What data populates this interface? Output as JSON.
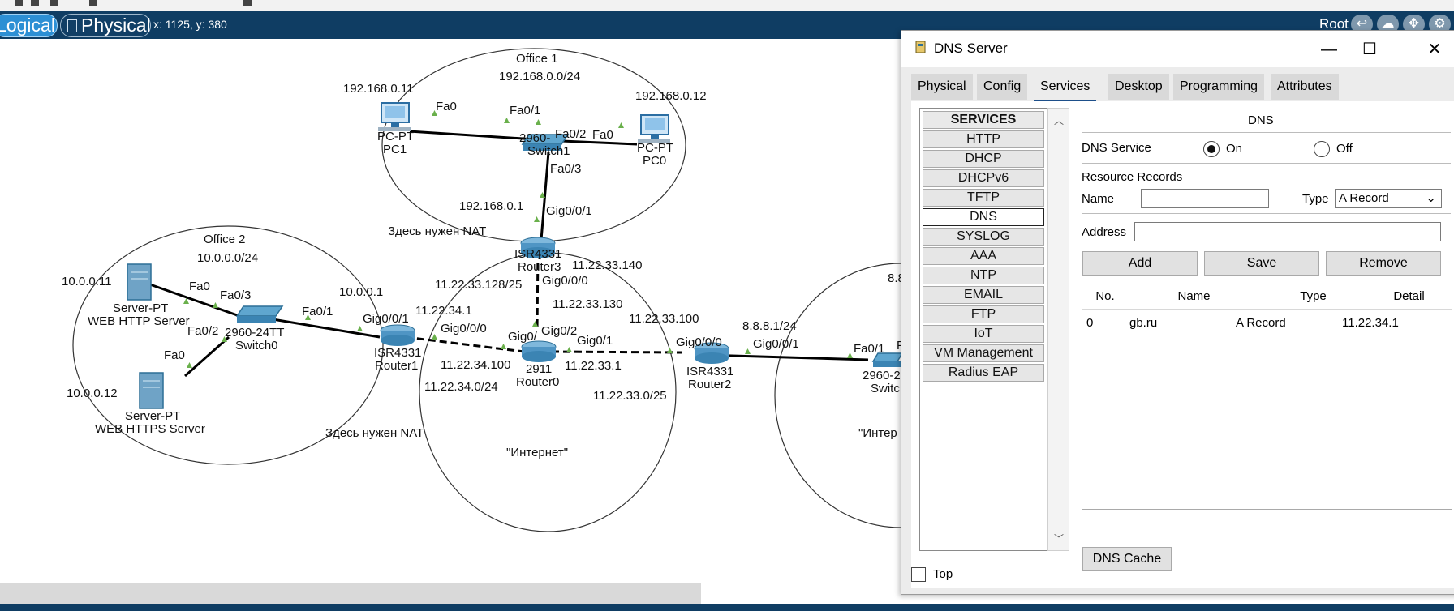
{
  "mode_bar": {
    "logical_label": "Logical",
    "physical_label": "Physical",
    "coords": "x: 1125, y: 380",
    "root_label": "Root"
  },
  "topology": {
    "areas": {
      "office1_title": "Office 1",
      "office1_net": "192.168.0.0/24",
      "office2_title": "Office 2",
      "office2_net": "10.0.0.0/24",
      "internet1": "\"Интернет\"",
      "internet2_partial": "\"Интер",
      "nat_note_1": "Здесь нужен NAT",
      "nat_note_2": "Здесь нужен NAT"
    },
    "devices": {
      "pc1_model": "PC-PT",
      "pc1_name": "PC1",
      "pc1_ip": "192.168.0.11",
      "pc0_model": "PC-PT",
      "pc0_name": "PC0",
      "pc0_ip": "192.168.0.12",
      "switch1_model": "2960-",
      "switch1_name": "Switch1",
      "router3_model": "ISR4331",
      "router3_name": "Router3",
      "server_http_model": "Server-PT",
      "server_http_name": "WEB HTTP Server",
      "server_http_ip": "10.0.0.11",
      "server_https_model": "Server-PT",
      "server_https_name": "WEB HTTPS Server",
      "server_https_ip": "10.0.0.12",
      "switch0_model": "2960-24TT",
      "switch0_name": "Switch0",
      "router1_model": "ISR4331",
      "router1_name": "Router1",
      "router0_model": "2911",
      "router0_name": "Router0",
      "router2_model": "ISR4331",
      "router2_name": "Router2",
      "switch_right_model": "2960-2",
      "switch_right_name": "Switc",
      "partial_right_ip": "8.8"
    },
    "ports": {
      "p_fa0_pc1": "Fa0",
      "p_fa01_sw1": "Fa0/1",
      "p_fa02_sw1": "Fa0/2",
      "p_fa0_pc0": "Fa0",
      "p_fa03_sw1": "Fa0/3",
      "gw_office1": "192.168.0.1",
      "p_gig001_r3": "Gig0/0/1",
      "p_gig000_r3": "Gig0/0/0",
      "ip_r3_wan": "11.22.33.140",
      "net_r3": "11.22.33.128/25",
      "ip_r0_r3": "11.22.33.130",
      "p_fa0_http": "Fa0",
      "p_fa03_sw0": "Fa0/3",
      "p_fa02_sw0": "Fa0/2",
      "p_fa0_https": "Fa0",
      "p_fa01_sw0": "Fa0/1",
      "gw_office2": "10.0.0.1",
      "p_gig001_r1": "Gig0/0/1",
      "ip_r1_wan": "11.22.34.1",
      "p_gig000_r1": "Gig0/0/0",
      "ip_r0_r1": "11.22.34.100",
      "net_r1": "11.22.34.0/24",
      "p_gig0_r0": "Gig0/",
      "p_gig02_r0": "Gig0/2",
      "p_gig01_r0": "Gig0/1",
      "ip_r0_r2": "11.22.33.1",
      "ip_r2_wan": "11.22.33.100",
      "p_gig000_r2": "Gig0/0/0",
      "net_r2": "11.22.33.0/25",
      "ip_r2_lan": "8.8.8.1/24",
      "p_gig001_r2": "Gig0/0/1",
      "p_fa01_swr": "Fa0/1",
      "p_partial_f": "F"
    }
  },
  "dns_window": {
    "title": "DNS Server",
    "controls": {
      "minimize": "—",
      "maximize": "☐",
      "close": "✕"
    },
    "tabs": [
      "Physical",
      "Config",
      "Services",
      "Desktop",
      "Programming",
      "Attributes"
    ],
    "active_tab": "Services",
    "services_header": "SERVICES",
    "services": [
      "HTTP",
      "DHCP",
      "DHCPv6",
      "TFTP",
      "DNS",
      "SYSLOG",
      "AAA",
      "NTP",
      "EMAIL",
      "FTP",
      "IoT",
      "VM Management",
      "Radius EAP"
    ],
    "selected_service": "DNS",
    "panel_title": "DNS",
    "dns_service_label": "DNS Service",
    "on_label": "On",
    "off_label": "Off",
    "dns_service_on": true,
    "resource_records_label": "Resource Records",
    "name_label": "Name",
    "name_value": "",
    "type_label": "Type",
    "type_value": "A Record",
    "address_label": "Address",
    "address_value": "",
    "add_button": "Add",
    "save_button": "Save",
    "remove_button": "Remove",
    "table_headers": [
      "No.",
      "Name",
      "Type",
      "Detail"
    ],
    "records": [
      {
        "no": "0",
        "name": "gb.ru",
        "type": "A Record",
        "detail": "11.22.34.1"
      }
    ],
    "dns_cache_button": "DNS Cache",
    "top_label": "Top",
    "top_checked": false
  },
  "colors": {
    "mode_bar": "#0f3d63",
    "logical_active": "#2c8fd4",
    "link_marker": "#6ab04c",
    "tab_underline": "#1d4f8a"
  },
  "icons": {
    "pc": "pc-icon",
    "switch": "switch-icon",
    "router": "router-icon",
    "server": "server-icon",
    "window": "dns-server-window-icon"
  }
}
